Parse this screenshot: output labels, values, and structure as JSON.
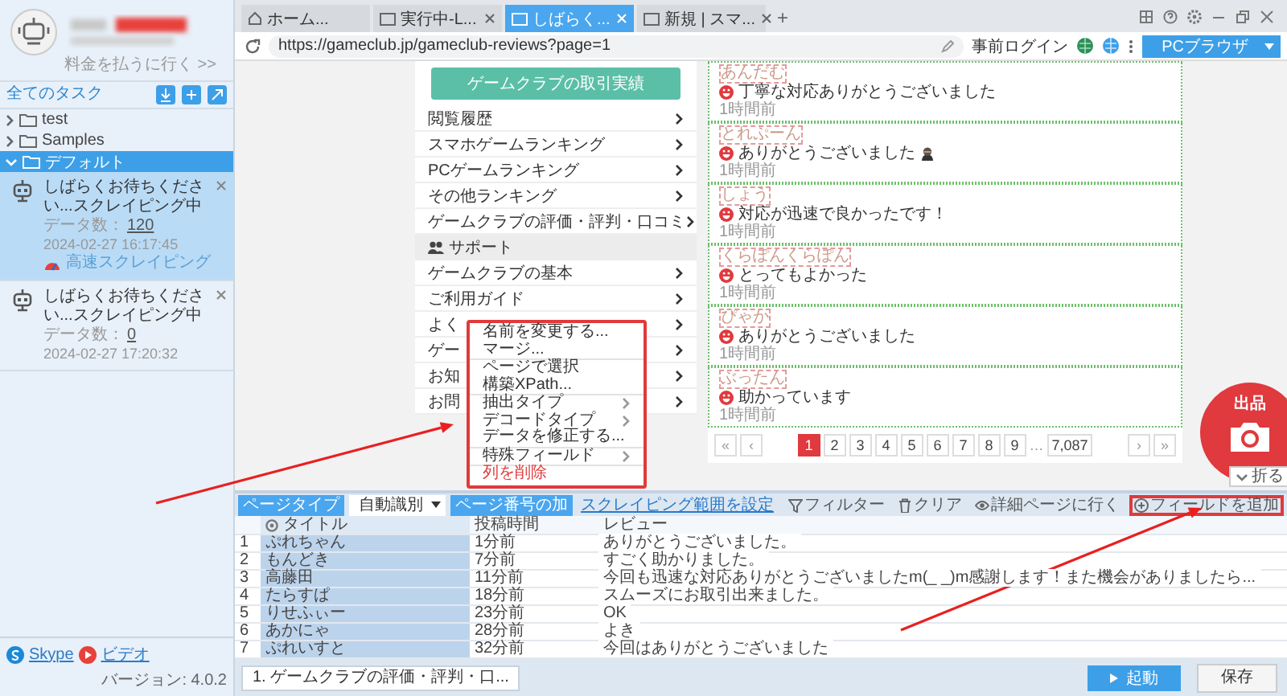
{
  "sidebar": {
    "upgrade_link": "料金を払うに行く >>",
    "tasks_heading": "全てのタスク",
    "folders": [
      {
        "name": "test",
        "expanded": false,
        "selected": false
      },
      {
        "name": "Samples",
        "expanded": false,
        "selected": false
      },
      {
        "name": "デフォルト",
        "expanded": true,
        "selected": true
      }
    ],
    "tasks": [
      {
        "title": "しばらくお待ちください...スクレイピング中",
        "count_label": "データ数：",
        "count": "120",
        "time": "2024-02-27 16:17:45",
        "status": "高速スクレイピング",
        "selected": true
      },
      {
        "title": "しばらくお待ちください...スクレイピング中",
        "count_label": "データ数：",
        "count": "0",
        "time": "2024-02-27 17:20:32",
        "selected": false
      }
    ],
    "footer": {
      "skype": "Skype",
      "video": "ビデオ",
      "version": "バージョン: 4.0.2"
    }
  },
  "browser": {
    "tabs": [
      {
        "label": "ホーム...",
        "kind": "home",
        "closable": false,
        "selected": false
      },
      {
        "label": "実行中-L...",
        "kind": "page",
        "closable": true,
        "selected": false
      },
      {
        "label": "しばらく...",
        "kind": "page",
        "closable": true,
        "selected": true
      },
      {
        "label": "新規 | スマ...",
        "kind": "page",
        "closable": true,
        "selected": false
      }
    ],
    "new_tab": "+",
    "url": "https://gameclub.jp/gameclub-reviews?page=1",
    "login": "事前ログイン",
    "mode": "PCブラウザ"
  },
  "page": {
    "menu_button": "ゲームクラブの取引実績",
    "menu": [
      {
        "label": "閲覧履歴",
        "kind": "link"
      },
      {
        "label": "スマホゲームランキング",
        "kind": "link"
      },
      {
        "label": "PCゲームランキング",
        "kind": "link"
      },
      {
        "label": "その他ランキング",
        "kind": "link"
      },
      {
        "label": "ゲームクラブの評価・評判・口コミ",
        "kind": "link"
      },
      {
        "label": "サポート",
        "kind": "section"
      },
      {
        "label": "ゲームクラブの基本",
        "kind": "link"
      },
      {
        "label": "ご利用ガイド",
        "kind": "link"
      },
      {
        "label": "よく",
        "kind": "link"
      },
      {
        "label": "ゲー",
        "kind": "link"
      },
      {
        "label": "お知",
        "kind": "link"
      },
      {
        "label": "お問",
        "kind": "link"
      }
    ],
    "reviews": [
      {
        "name": "あんだむ",
        "text": "丁寧な対応ありがとうございました",
        "time": "1時間前",
        "sticker": false
      },
      {
        "name": "とれぷーん",
        "text": "ありがとうございました",
        "time": "1時間前",
        "sticker": true
      },
      {
        "name": "しょう",
        "text": "対応が迅速で良かったです！",
        "time": "1時間前",
        "sticker": false
      },
      {
        "name": "くらぽんくらぽん",
        "text": "とってもよかった",
        "time": "1時間前",
        "sticker": false
      },
      {
        "name": "ぴゃか",
        "text": "ありがとうございました",
        "time": "1時間前",
        "sticker": false
      },
      {
        "name": "ぶったん",
        "text": "助かっています",
        "time": "1時間前",
        "sticker": false
      }
    ],
    "pagination": [
      {
        "label": "«",
        "kind": "nav"
      },
      {
        "label": "‹",
        "kind": "nav"
      },
      {
        "label": "1",
        "kind": "page",
        "selected": true
      },
      {
        "label": "2",
        "kind": "page",
        "selected": false
      },
      {
        "label": "3",
        "kind": "page",
        "selected": false
      },
      {
        "label": "4",
        "kind": "page",
        "selected": false
      },
      {
        "label": "5",
        "kind": "page",
        "selected": false
      },
      {
        "label": "6",
        "kind": "page",
        "selected": false
      },
      {
        "label": "7",
        "kind": "page",
        "selected": false
      },
      {
        "label": "8",
        "kind": "page",
        "selected": false
      },
      {
        "label": "9",
        "kind": "page",
        "selected": false
      },
      {
        "label": "…",
        "kind": "gap"
      },
      {
        "label": "7,087",
        "kind": "page",
        "selected": false
      },
      {
        "label": "›",
        "kind": "nav"
      },
      {
        "label": "»",
        "kind": "nav"
      }
    ]
  },
  "float_button": {
    "label": "出品",
    "collapse": "折る"
  },
  "context_menu": [
    {
      "label": "名前を変更する...",
      "submenu": false,
      "danger": false,
      "divider_before": false
    },
    {
      "label": "マージ...",
      "submenu": false,
      "danger": false,
      "divider_before": false
    },
    {
      "label": "ページで選択",
      "submenu": false,
      "danger": false,
      "divider_before": true
    },
    {
      "label": "構築XPath...",
      "submenu": false,
      "danger": false,
      "divider_before": false
    },
    {
      "label": "抽出タイプ",
      "submenu": true,
      "danger": false,
      "divider_before": true
    },
    {
      "label": "デコードタイプ",
      "submenu": true,
      "danger": false,
      "divider_before": false
    },
    {
      "label": "データを修正する...",
      "submenu": false,
      "danger": false,
      "divider_before": false
    },
    {
      "label": "特殊フィールド",
      "submenu": true,
      "danger": false,
      "divider_before": true
    },
    {
      "label": "列を削除",
      "submenu": false,
      "danger": true,
      "divider_before": true
    }
  ],
  "editor": {
    "page_type_label": "ページタイプ",
    "page_type": "自動識別",
    "page_number_button": "ページ番号の加",
    "scope_link": "スクレイピング範囲を設定",
    "actions": [
      {
        "label": "フィルター",
        "kind": "filter",
        "highlighted": false
      },
      {
        "label": "クリア",
        "kind": "clear",
        "highlighted": false
      },
      {
        "label": "詳細ページに行く",
        "kind": "detail",
        "highlighted": false
      },
      {
        "label": "フィールドを追加",
        "kind": "add",
        "highlighted": true
      }
    ],
    "columns": [
      {
        "label": "タイトル",
        "selected": true
      },
      {
        "label": "投稿時間",
        "selected": false
      },
      {
        "label": "レビュー",
        "selected": false
      }
    ],
    "rows": [
      {
        "index": "1",
        "title": "ぷれちゃん",
        "time": "1分前",
        "review": "ありがとうございました。"
      },
      {
        "index": "2",
        "title": "もんどき",
        "time": "7分前",
        "review": "すごく助かりました。"
      },
      {
        "index": "3",
        "title": "高藤田",
        "time": "11分前",
        "review": "今回も迅速な対応ありがとうございましたm(_ _)m感謝します！また機会がありましたら..."
      },
      {
        "index": "4",
        "title": "たらすぱ",
        "time": "18分前",
        "review": "スムーズにお取引出来ました。"
      },
      {
        "index": "5",
        "title": "りせふぃー",
        "time": "23分前",
        "review": "OK"
      },
      {
        "index": "6",
        "title": "あかにゃ",
        "time": "28分前",
        "review": "よき"
      },
      {
        "index": "7",
        "title": "ぷれいすと",
        "time": "32分前",
        "review": "今回はありがとうございました"
      }
    ],
    "task_tab": "1. ゲームクラブの評価・評判・口...",
    "start": "起動",
    "save": "保存"
  }
}
